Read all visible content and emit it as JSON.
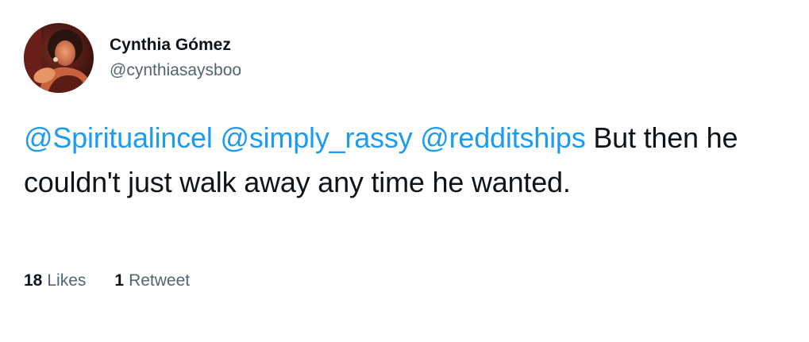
{
  "author": {
    "display_name": "Cynthia Gómez",
    "handle": "@cynthiasaysboo"
  },
  "tweet": {
    "mentions": [
      "@Spiritualincel",
      "@simply_rassy",
      "@redditships"
    ],
    "text": "But then he couldn't just walk away any time he wanted."
  },
  "stats": {
    "likes_count": "18",
    "likes_label": "Likes",
    "retweets_count": "1",
    "retweets_label": "Retweet"
  },
  "colors": {
    "mention": "#1d9bf0",
    "text": "#0f1419",
    "secondary": "#536471"
  }
}
